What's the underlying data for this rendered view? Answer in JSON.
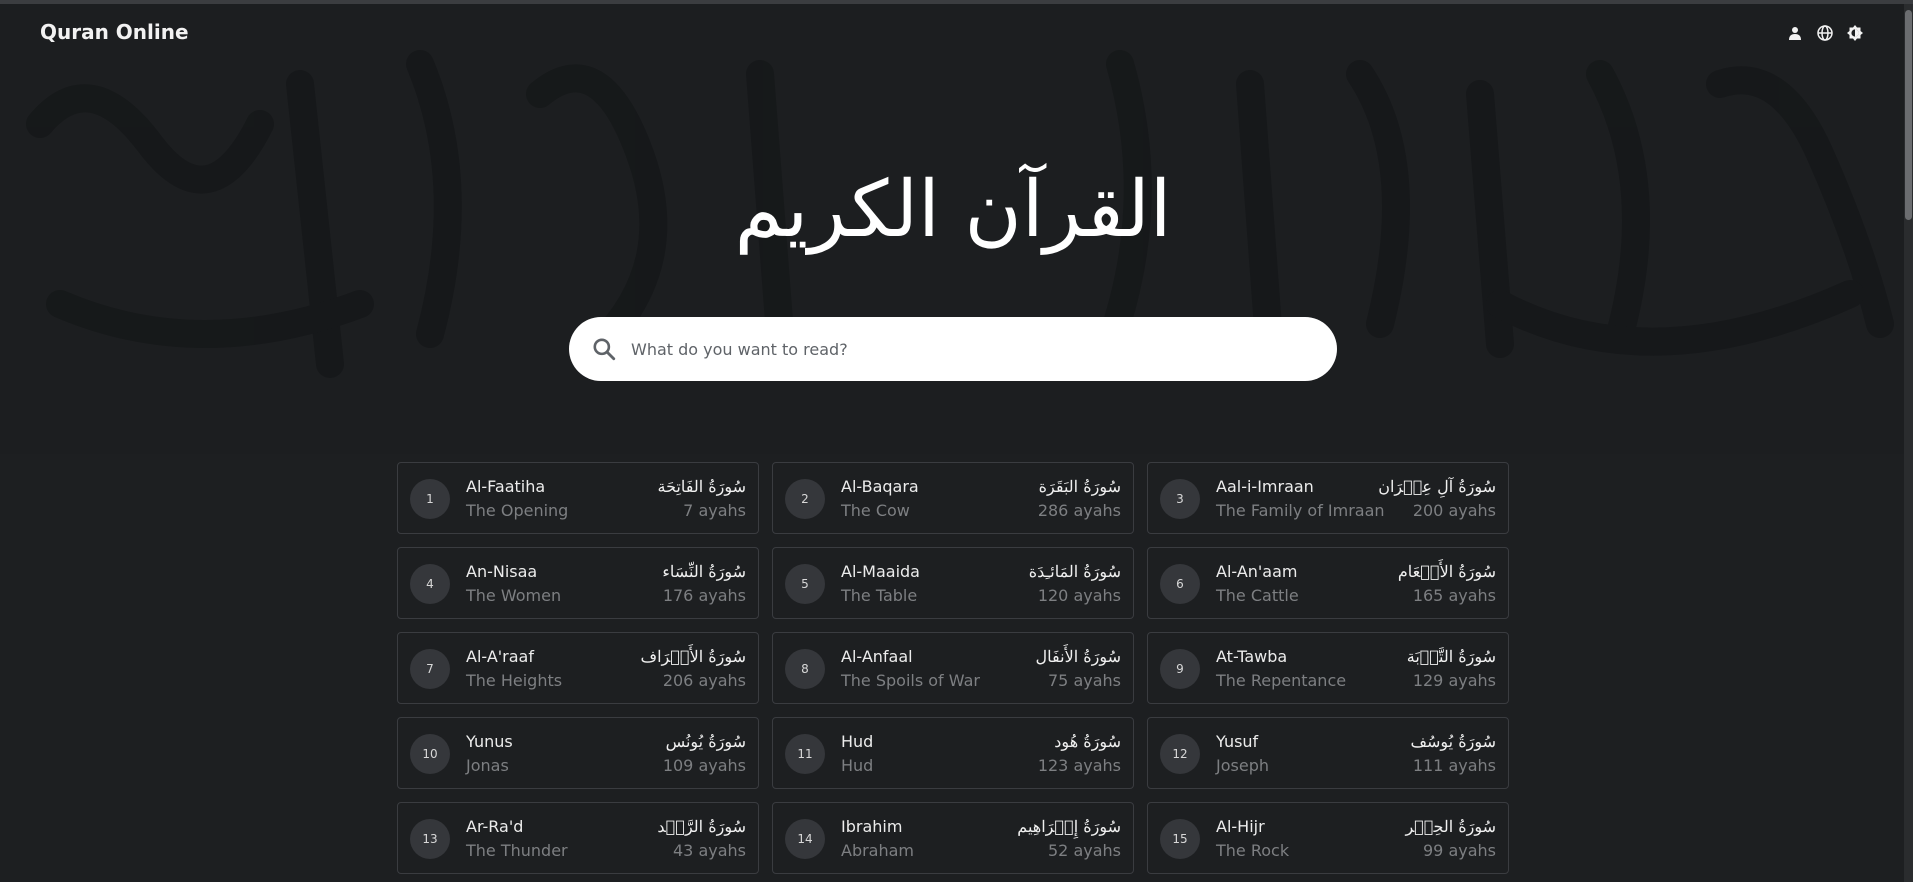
{
  "brand": "Quran Online",
  "header_icons": [
    "user-icon",
    "globe-icon",
    "theme-toggle-icon"
  ],
  "calligraphy": "القرآن الكريم",
  "search": {
    "placeholder": "What do you want to read?"
  },
  "surahs": [
    {
      "number": "1",
      "name": "Al-Faatiha",
      "meaning": "The Opening",
      "arabic": "سُورَةُ الفَاتِحَة",
      "ayahs": "7 ayahs"
    },
    {
      "number": "2",
      "name": "Al-Baqara",
      "meaning": "The Cow",
      "arabic": "سُورَةُ البَقَرَة",
      "ayahs": "286 ayahs"
    },
    {
      "number": "3",
      "name": "Aal-i-Imraan",
      "meaning": "The Family of Imraan",
      "arabic": "سُورَةُ آلِ عِمۡرَان",
      "ayahs": "200 ayahs"
    },
    {
      "number": "4",
      "name": "An-Nisaa",
      "meaning": "The Women",
      "arabic": "سُورَةُ النِّسَاء",
      "ayahs": "176 ayahs"
    },
    {
      "number": "5",
      "name": "Al-Maaida",
      "meaning": "The Table",
      "arabic": "سُورَةُ المَائـِدَة",
      "ayahs": "120 ayahs"
    },
    {
      "number": "6",
      "name": "Al-An'aam",
      "meaning": "The Cattle",
      "arabic": "سُورَةُ الأَنۡعَام",
      "ayahs": "165 ayahs"
    },
    {
      "number": "7",
      "name": "Al-A'raaf",
      "meaning": "The Heights",
      "arabic": "سُورَةُ الأَعۡرَاف",
      "ayahs": "206 ayahs"
    },
    {
      "number": "8",
      "name": "Al-Anfaal",
      "meaning": "The Spoils of War",
      "arabic": "سُورَةُ الأَنفَال",
      "ayahs": "75 ayahs"
    },
    {
      "number": "9",
      "name": "At-Tawba",
      "meaning": "The Repentance",
      "arabic": "سُورَةُ التَّوۡبَة",
      "ayahs": "129 ayahs"
    },
    {
      "number": "10",
      "name": "Yunus",
      "meaning": "Jonas",
      "arabic": "سُورَةُ يُونُس",
      "ayahs": "109 ayahs"
    },
    {
      "number": "11",
      "name": "Hud",
      "meaning": "Hud",
      "arabic": "سُورَةُ هُود",
      "ayahs": "123 ayahs"
    },
    {
      "number": "12",
      "name": "Yusuf",
      "meaning": "Joseph",
      "arabic": "سُورَةُ يُوسُف",
      "ayahs": "111 ayahs"
    },
    {
      "number": "13",
      "name": "Ar-Ra'd",
      "meaning": "The Thunder",
      "arabic": "سُورَةُ الرَّعۡد",
      "ayahs": "43 ayahs"
    },
    {
      "number": "14",
      "name": "Ibrahim",
      "meaning": "Abraham",
      "arabic": "سُورَةُ إِبۡرَاهِيم",
      "ayahs": "52 ayahs"
    },
    {
      "number": "15",
      "name": "Al-Hijr",
      "meaning": "The Rock",
      "arabic": "سُورَةُ الحِجۡر",
      "ayahs": "99 ayahs"
    }
  ],
  "colors": {
    "background": "#1d1f21",
    "card_border": "#3a3c40",
    "number_badge": "#35373b",
    "muted_text": "#7d7f82"
  }
}
